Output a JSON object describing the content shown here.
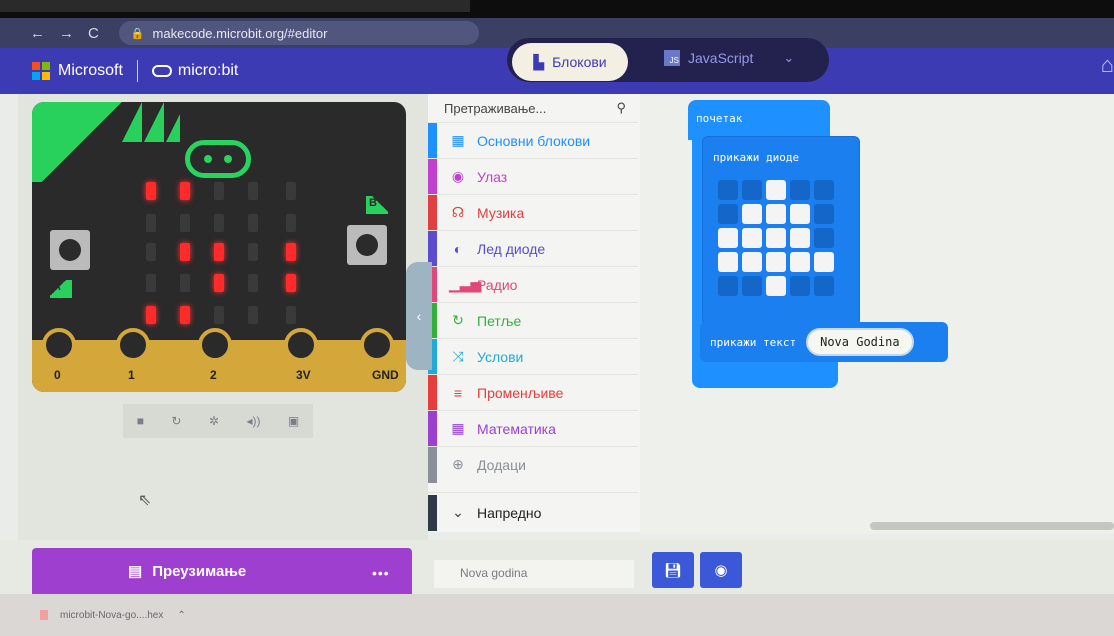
{
  "browser": {
    "url": "makecode.microbit.org/#editor"
  },
  "header": {
    "brand": "Microsoft",
    "product": "micro:bit",
    "tab_blocks": "Блокови",
    "tab_js": "JavaScript",
    "js_badge": "JS"
  },
  "simulator": {
    "label_a": "A",
    "label_b": "B",
    "pins": [
      "0",
      "1",
      "2",
      "3V",
      "GND"
    ],
    "led_matrix": [
      [
        1,
        1,
        0,
        0,
        0
      ],
      [
        0,
        0,
        0,
        0,
        0
      ],
      [
        0,
        1,
        1,
        0,
        1
      ],
      [
        0,
        0,
        1,
        0,
        1
      ],
      [
        1,
        1,
        0,
        0,
        0
      ]
    ]
  },
  "toolbox": {
    "search_placeholder": "Претраживање...",
    "categories": [
      {
        "label": "Основни блокови",
        "color": "#1e90ff",
        "icon": "grid-icon"
      },
      {
        "label": "Улаз",
        "color": "#c040d0",
        "icon": "circle-icon"
      },
      {
        "label": "Музика",
        "color": "#e04040",
        "icon": "headphones-icon"
      },
      {
        "label": "Лед диоде",
        "color": "#5b4bd0",
        "icon": "toggle-icon"
      },
      {
        "label": "Радио",
        "color": "#e0487a",
        "icon": "signal-icon"
      },
      {
        "label": "Петље",
        "color": "#33b03a",
        "icon": "loop-icon"
      },
      {
        "label": "Услови",
        "color": "#24a8d8",
        "icon": "shuffle-icon"
      },
      {
        "label": "Променљиве",
        "color": "#e83c3c",
        "icon": "list-icon"
      },
      {
        "label": "Математика",
        "color": "#9b3fd0",
        "icon": "calculator-icon"
      },
      {
        "label": "Додаци",
        "color": "#8b8f99",
        "icon": "plus-icon"
      },
      {
        "label": "Напредно",
        "color": "#2e3a48",
        "icon": "chevron-down-icon"
      }
    ]
  },
  "workspace": {
    "start_block": "почетак",
    "show_leds_block": "прикажи диоде",
    "show_text_block": "прикажи текст",
    "text_value": "Nova Godina",
    "led_grid": [
      [
        0,
        0,
        1,
        0,
        0
      ],
      [
        0,
        1,
        1,
        1,
        0
      ],
      [
        1,
        1,
        1,
        1,
        0
      ],
      [
        1,
        1,
        1,
        1,
        1
      ],
      [
        0,
        0,
        1,
        0,
        0
      ]
    ]
  },
  "footer": {
    "download_label": "Преузимање",
    "more_label": "•••",
    "project_name": "Nova godina"
  },
  "downloads": {
    "file": "microbit-Nova-go....hex"
  }
}
